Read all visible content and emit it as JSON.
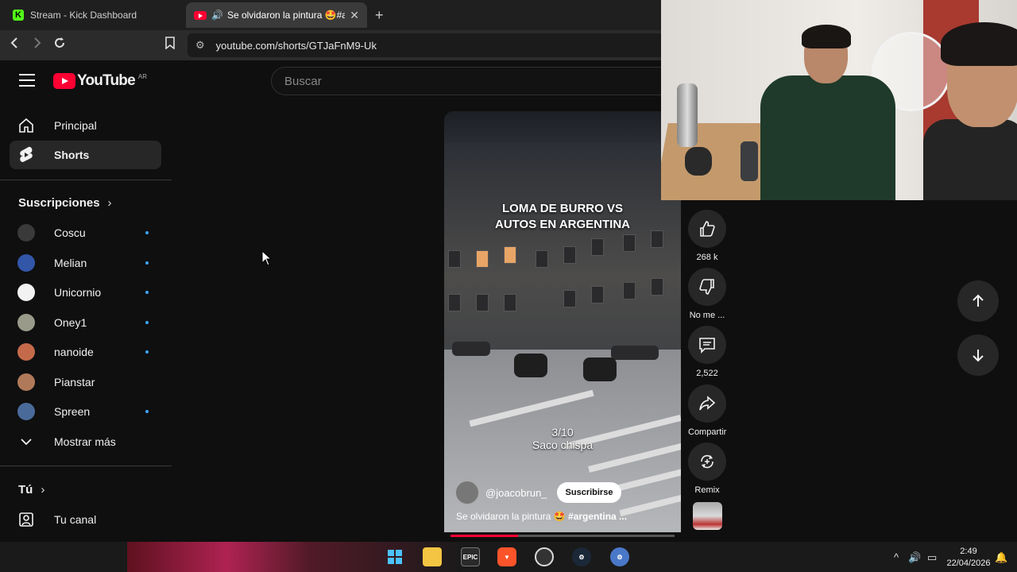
{
  "browser": {
    "tabs": [
      {
        "title": "Stream - Kick Dashboard",
        "icon": "kick-icon"
      },
      {
        "title": "Se olvidaron la pintura 🤩#ar",
        "icon": "youtube-icon"
      }
    ],
    "url": "youtube.com/shorts/GTJaFnM9-Uk"
  },
  "youtube": {
    "logo_text": "YouTube",
    "country_code": "AR",
    "search_placeholder": "Buscar",
    "nav": [
      {
        "label": "Principal",
        "icon": "home-icon"
      },
      {
        "label": "Shorts",
        "icon": "shorts-icon",
        "active": true
      }
    ],
    "subscriptions_title": "Suscripciones",
    "subscriptions": [
      {
        "name": "Coscu",
        "new": true,
        "color": "#3a3a3a"
      },
      {
        "name": "Melian",
        "new": true,
        "color": "#3256a8"
      },
      {
        "name": "Unicornio",
        "new": true,
        "color": "#f2f2f2"
      },
      {
        "name": "Oney1",
        "new": true,
        "color": "#9a9a8a"
      },
      {
        "name": "nanoide",
        "new": true,
        "color": "#c46a4a"
      },
      {
        "name": "Pianstar",
        "new": false,
        "color": "#b07a5a"
      },
      {
        "name": "Spreen",
        "new": true,
        "color": "#4a6a9a"
      }
    ],
    "show_more": "Mostrar más",
    "you_title": "Tú",
    "your_channel": "Tu canal"
  },
  "short": {
    "title_line1": "LOMA DE BURRO VS",
    "title_line2": "AUTOS EN ARGENTINA",
    "rating_line1": "3/10",
    "rating_line2": "Saco chispa",
    "channel": "@joacobrun_",
    "subscribe": "Suscribirse",
    "caption_text": "Se olvidaron la pintura 🤩 ",
    "caption_tag": "#argentina ...",
    "progress": 0.3
  },
  "actions": {
    "likes": "268 k",
    "dislike": "No me ...",
    "comments": "2,522",
    "share": "Compartir",
    "remix": "Remix"
  },
  "taskbar": {
    "time": "2:49",
    "date": "22/04/2026"
  },
  "colors": {
    "yt_red": "#ff0033",
    "accent_blue": "#3ea6ff",
    "bg": "#0f0f0f"
  }
}
